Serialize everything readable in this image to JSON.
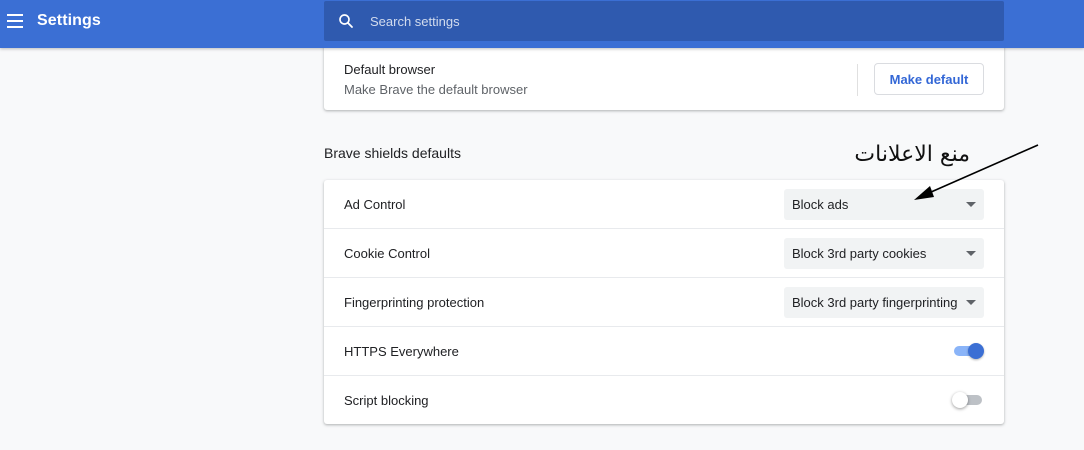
{
  "header": {
    "title": "Settings",
    "search_placeholder": "Search settings"
  },
  "default_browser": {
    "title": "Default browser",
    "subtitle": "Make Brave the default browser",
    "button_label": "Make default"
  },
  "shields": {
    "section_title": "Brave shields defaults",
    "rows": [
      {
        "label": "Ad Control",
        "type": "select",
        "value": "Block ads"
      },
      {
        "label": "Cookie Control",
        "type": "select",
        "value": "Block 3rd party cookies"
      },
      {
        "label": "Fingerprinting protection",
        "type": "select",
        "value": "Block 3rd party fingerprinting"
      },
      {
        "label": "HTTPS Everywhere",
        "type": "toggle",
        "on": true
      },
      {
        "label": "Script blocking",
        "type": "toggle",
        "on": false
      }
    ]
  },
  "annotation": {
    "text": "منع الاعلانات"
  },
  "colors": {
    "header_bg": "#3b6fd4",
    "accent": "#3367d6"
  },
  "icons": {
    "menu": "hamburger-menu-icon",
    "search": "search-icon",
    "dropdown": "chevron-down-icon"
  }
}
